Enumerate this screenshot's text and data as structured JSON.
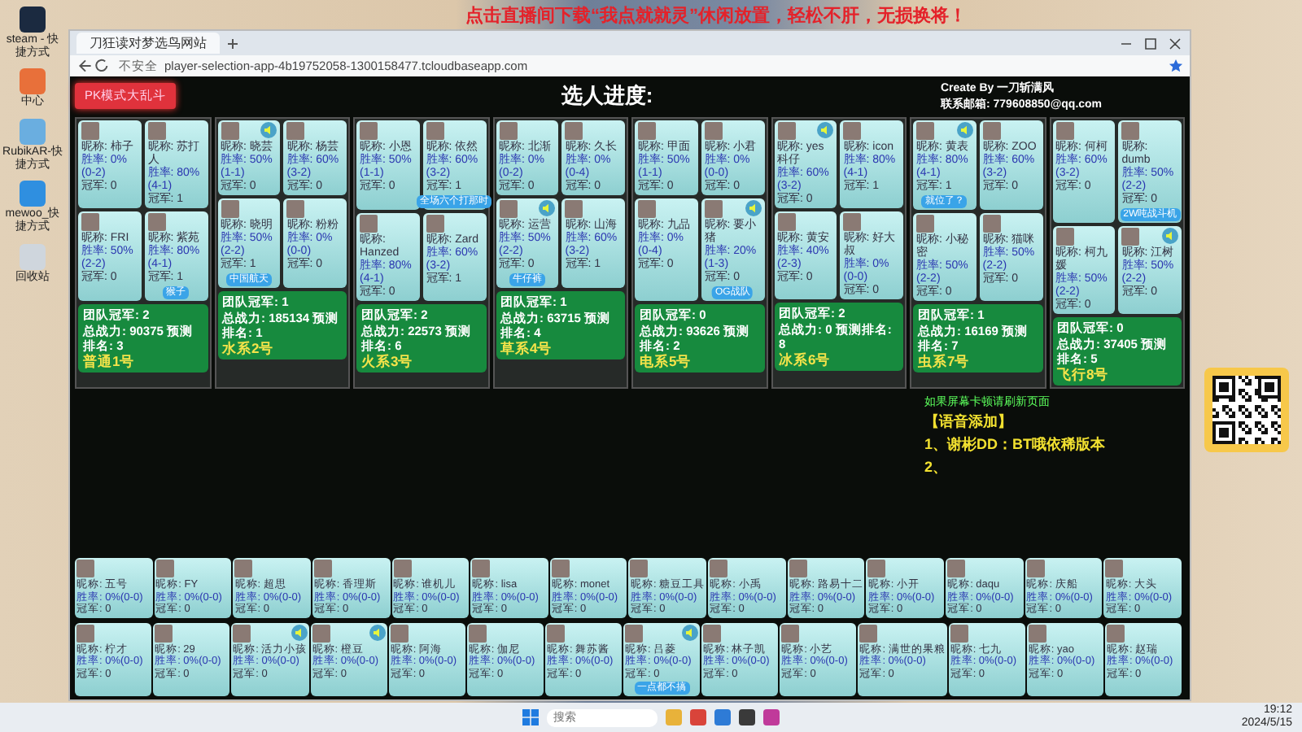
{
  "desktop": {
    "icons": [
      {
        "label": "steam - 快捷方式"
      },
      {
        "label": "中心"
      },
      {
        "label": "RubikAR-快捷方式"
      },
      {
        "label": "mewoo_快捷方式"
      },
      {
        "label": "回收站"
      }
    ]
  },
  "banner": "点击直播间下载“我点就就灵”休闲放置，轻松不肝，无损换将！",
  "browser": {
    "tab_title": "刀狂读对梦选鸟网站",
    "security": "不安全",
    "url": "player-selection-app-4b19752058-1300158477.tcloudbaseapp.com"
  },
  "page": {
    "mode_button": "PK模式大乱斗",
    "title": "选人进度:",
    "credit": "Create By 一刀斩满风",
    "contact": "联系邮箱: 779608850@qq.com",
    "teams": [
      {
        "cards": [
          {
            "name": "昵称: 柿子",
            "rate": "胜率: 0%(0-2)",
            "titles": "冠军: 0",
            "voice": false
          },
          {
            "name": "昵称: 苏打人",
            "rate": "胜率: 80%(4-1)",
            "titles": "冠军: 1",
            "voice": false
          },
          {
            "name": "昵称: FRI",
            "rate": "胜率: 50%(2-2)",
            "titles": "冠军: 0",
            "voice": false
          },
          {
            "name": "昵称: 紫苑",
            "rate": "胜率: 80%(4-1)",
            "titles": "冠军: 1",
            "voice": false,
            "tag": "猴子"
          }
        ],
        "champions": "团队冠军: 2",
        "power": "总战力: 90375 预测排名: 3",
        "name": "普通1号"
      },
      {
        "cards": [
          {
            "name": "昵称: 晓芸",
            "rate": "胜率: 50%(1-1)",
            "titles": "冠军: 0",
            "voice": true
          },
          {
            "name": "昵称: 杨芸",
            "rate": "胜率: 60%(3-2)",
            "titles": "冠军: 0",
            "voice": false
          },
          {
            "name": "昵称: 晓明",
            "rate": "胜率: 50%(2-2)",
            "titles": "冠军: 1",
            "voice": false,
            "tag": "中国航天"
          },
          {
            "name": "昵称: 粉粉",
            "rate": "胜率: 0%(0-0)",
            "titles": "冠军: 0",
            "voice": false
          }
        ],
        "champions": "团队冠军: 1",
        "power": "总战力: 185134 预测排名: 1",
        "name": "水系2号"
      },
      {
        "cards": [
          {
            "name": "昵称: 小恩",
            "rate": "胜率: 50%(1-1)",
            "titles": "冠军: 0",
            "voice": false
          },
          {
            "name": "昵称: 依然",
            "rate": "胜率: 60%(3-2)",
            "titles": "冠军: 1",
            "voice": false,
            "tag": "全场六个打那时"
          },
          {
            "name": "昵称: Hanzed",
            "rate": "胜率: 80%(4-1)",
            "titles": "冠军: 0",
            "voice": false
          },
          {
            "name": "昵称: Zard",
            "rate": "胜率: 60%(3-2)",
            "titles": "冠军: 1",
            "voice": false
          }
        ],
        "champions": "团队冠军: 2",
        "power": "总战力: 22573 预测排名: 6",
        "name": "火系3号"
      },
      {
        "cards": [
          {
            "name": "昵称: 北渐",
            "rate": "胜率: 0%(0-2)",
            "titles": "冠军: 0",
            "voice": false
          },
          {
            "name": "昵称: 久长",
            "rate": "胜率: 0%(0-4)",
            "titles": "冠军: 0",
            "voice": false
          },
          {
            "name": "昵称: 运营",
            "rate": "胜率: 50%(2-2)",
            "titles": "冠军: 0",
            "voice": true,
            "tag": "牛仔裤"
          },
          {
            "name": "昵称: 山海",
            "rate": "胜率: 60%(3-2)",
            "titles": "冠军: 1",
            "voice": false
          }
        ],
        "champions": "团队冠军: 1",
        "power": "总战力: 63715 预测排名: 4",
        "name": "草系4号"
      },
      {
        "cards": [
          {
            "name": "昵称: 甲面",
            "rate": "胜率: 50%(1-1)",
            "titles": "冠军: 0",
            "voice": false
          },
          {
            "name": "昵称: 小君",
            "rate": "胜率: 0%(0-0)",
            "titles": "冠军: 0",
            "voice": false
          },
          {
            "name": "昵称: 九品",
            "rate": "胜率: 0%(0-4)",
            "titles": "冠军: 0",
            "voice": false
          },
          {
            "name": "昵称: 要小猪",
            "rate": "胜率: 20%(1-3)",
            "titles": "冠军: 0",
            "voice": true,
            "tag": "OG战队"
          }
        ],
        "champions": "团队冠军: 0",
        "power": "总战力: 93626 预测排名: 2",
        "name": "电系5号"
      },
      {
        "cards": [
          {
            "name": "昵称: yes科仔",
            "rate": "胜率: 60%(3-2)",
            "titles": "冠军: 0",
            "voice": true
          },
          {
            "name": "昵称: icon",
            "rate": "胜率: 80%(4-1)",
            "titles": "冠军: 1",
            "voice": false
          },
          {
            "name": "昵称: 黄安",
            "rate": "胜率: 40%(2-3)",
            "titles": "冠军: 0",
            "voice": false
          },
          {
            "name": "昵称: 好大叔",
            "rate": "胜率: 0%(0-0)",
            "titles": "冠军: 0",
            "voice": false
          }
        ],
        "champions": "团队冠军: 2",
        "power": "总战力: 0 预测排名: 8",
        "name": "冰系6号"
      },
      {
        "cards": [
          {
            "name": "昵称: 黄表",
            "rate": "胜率: 80%(4-1)",
            "titles": "冠军: 1",
            "voice": true,
            "tag": "就位了？"
          },
          {
            "name": "昵称: ZOO",
            "rate": "胜率: 60%(3-2)",
            "titles": "冠军: 0",
            "voice": false
          },
          {
            "name": "昵称: 小秘密",
            "rate": "胜率: 50%(2-2)",
            "titles": "冠军: 0",
            "voice": false
          },
          {
            "name": "昵称: 猫咪",
            "rate": "胜率: 50%(2-2)",
            "titles": "冠军: 0",
            "voice": false
          }
        ],
        "champions": "团队冠军: 1",
        "power": "总战力: 16169 预测排名: 7",
        "name": "虫系7号"
      },
      {
        "cards": [
          {
            "name": "昵称: 何柯",
            "rate": "胜率: 60%(3-2)",
            "titles": "冠军: 0",
            "voice": false
          },
          {
            "name": "昵称: dumb",
            "rate": "胜率: 50%(2-2)",
            "titles": "冠军: 0",
            "voice": false,
            "tag": "2W吨战斗机"
          },
          {
            "name": "昵称: 柯九媛",
            "rate": "胜率: 50%(2-2)",
            "titles": "冠军: 0",
            "voice": false
          },
          {
            "name": "昵称: 江树",
            "rate": "胜率: 50%(2-2)",
            "titles": "冠军: 0",
            "voice": true
          }
        ],
        "champions": "团队冠军: 0",
        "power": "总战力: 37405 预测排名: 5",
        "name": "飞行8号"
      }
    ],
    "notice": {
      "tip": "如果屏幕卡顿请刷新页面",
      "heading": "【语音添加】",
      "lines": [
        "1、谢彬DD：BT哦依稀版本",
        "2、"
      ]
    },
    "pool": [
      [
        {
          "name": "昵称: 五号",
          "rate": "胜率: 0%(0-0)",
          "titles": "冠军: 0",
          "voice": false
        },
        {
          "name": "昵称: FY",
          "rate": "胜率: 0%(0-0)",
          "titles": "冠军: 0",
          "voice": false
        },
        {
          "name": "昵称: 超思",
          "rate": "胜率: 0%(0-0)",
          "titles": "冠军: 0",
          "voice": false
        },
        {
          "name": "昵称: 香理斯",
          "rate": "胜率: 0%(0-0)",
          "titles": "冠军: 0",
          "voice": false
        },
        {
          "name": "昵称: 谁机儿",
          "rate": "胜率: 0%(0-0)",
          "titles": "冠军: 0",
          "voice": false
        },
        {
          "name": "昵称: lisa",
          "rate": "胜率: 0%(0-0)",
          "titles": "冠军: 0",
          "voice": false
        },
        {
          "name": "昵称: monet",
          "rate": "胜率: 0%(0-0)",
          "titles": "冠军: 0",
          "voice": false
        },
        {
          "name": "昵称: 糖豆工具",
          "rate": "胜率: 0%(0-0)",
          "titles": "冠军: 0",
          "voice": false
        },
        {
          "name": "昵称: 小禹",
          "rate": "胜率: 0%(0-0)",
          "titles": "冠军: 0",
          "voice": false
        },
        {
          "name": "昵称: 路易十二",
          "rate": "胜率: 0%(0-0)",
          "titles": "冠军: 0",
          "voice": false
        },
        {
          "name": "昵称: 小开",
          "rate": "胜率: 0%(0-0)",
          "titles": "冠军: 0",
          "voice": false
        },
        {
          "name": "昵称: daqu",
          "rate": "胜率: 0%(0-0)",
          "titles": "冠军: 0",
          "voice": false
        },
        {
          "name": "昵称: 庆船",
          "rate": "胜率: 0%(0-0)",
          "titles": "冠军: 0",
          "voice": false
        },
        {
          "name": "昵称: 大头",
          "rate": "胜率: 0%(0-0)",
          "titles": "冠军: 0",
          "voice": false
        }
      ],
      [
        {
          "name": "昵称: 柠才",
          "rate": "胜率: 0%(0-0)",
          "titles": "冠军: 0",
          "voice": false
        },
        {
          "name": "昵称: 29",
          "rate": "胜率: 0%(0-0)",
          "titles": "冠军: 0",
          "voice": false
        },
        {
          "name": "昵称: 活力小孩",
          "rate": "胜率: 0%(0-0)",
          "titles": "冠军: 0",
          "voice": true
        },
        {
          "name": "昵称: 橙豆",
          "rate": "胜率: 0%(0-0)",
          "titles": "冠军: 0",
          "voice": true
        },
        {
          "name": "昵称: 阿海",
          "rate": "胜率: 0%(0-0)",
          "titles": "冠军: 0",
          "voice": false
        },
        {
          "name": "昵称: 伽尼",
          "rate": "胜率: 0%(0-0)",
          "titles": "冠军: 0",
          "voice": false
        },
        {
          "name": "昵称: 舞苏酱",
          "rate": "胜率: 0%(0-0)",
          "titles": "冠军: 0",
          "voice": false
        },
        {
          "name": "昵称: 吕菱",
          "rate": "胜率: 0%(0-0)",
          "titles": "冠军: 0",
          "voice": true,
          "tag": "一点都不搞"
        },
        {
          "name": "昵称: 林子凯",
          "rate": "胜率: 0%(0-0)",
          "titles": "冠军: 0",
          "voice": false
        },
        {
          "name": "昵称: 小艺",
          "rate": "胜率: 0%(0-0)",
          "titles": "冠军: 0",
          "voice": false
        },
        {
          "name": "昵称: 满世的果粮",
          "rate": "胜率: 0%(0-0)",
          "titles": "冠军: 0",
          "voice": false
        },
        {
          "name": "昵称: 七九",
          "rate": "胜率: 0%(0-0)",
          "titles": "冠军: 0",
          "voice": false
        },
        {
          "name": "昵称: yao",
          "rate": "胜率: 0%(0-0)",
          "titles": "冠军: 0",
          "voice": false
        },
        {
          "name": "昵称: 赵瑞",
          "rate": "胜率: 0%(0-0)",
          "titles": "冠军: 0",
          "voice": false
        }
      ]
    ]
  },
  "taskbar": {
    "search_placeholder": "搜索",
    "time": "19:12",
    "date": "2024/5/15"
  }
}
